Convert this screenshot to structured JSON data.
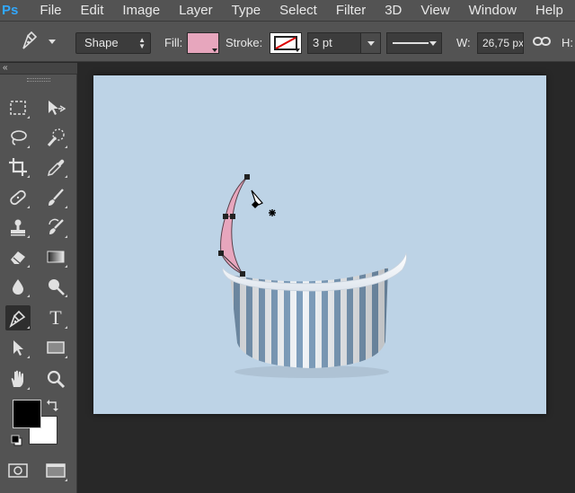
{
  "app": {
    "logo": "Ps",
    "menu": [
      "File",
      "Edit",
      "Image",
      "Layer",
      "Type",
      "Select",
      "Filter",
      "3D",
      "View",
      "Window",
      "Help"
    ]
  },
  "options_bar": {
    "tool_mode": "Shape",
    "fill_label": "Fill:",
    "fill_color": "#e7a6bd",
    "stroke_label": "Stroke:",
    "stroke_width": "3 pt",
    "width_label": "W:",
    "width_value": "26,75 px",
    "height_label": "H:"
  },
  "toolbox": {
    "collapse_glyph": "«",
    "type_tool_glyph": "T",
    "foreground_color": "#000000",
    "background_color": "#ffffff",
    "active_tool": "pen-tool"
  },
  "canvas": {
    "background_color": "#bdd3e6",
    "cup_stripe_blue": "#7f9fbd",
    "cup_stripe_white": "#f2f5f8",
    "path_fill": "#e7a6bd"
  }
}
